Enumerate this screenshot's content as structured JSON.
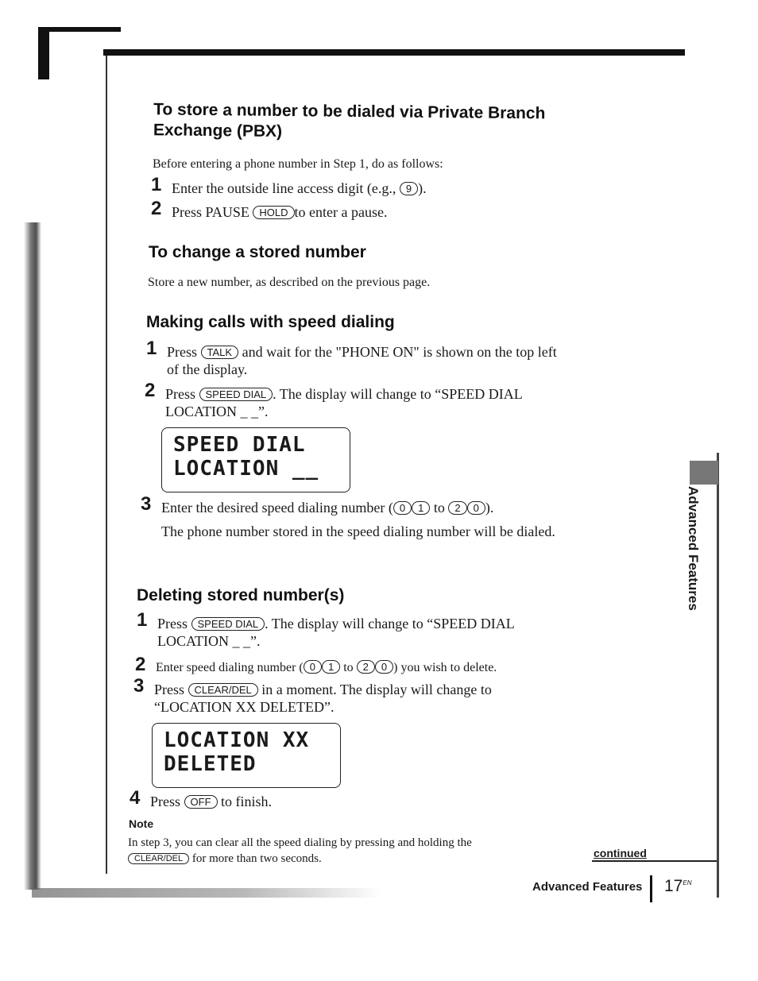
{
  "pbx": {
    "heading": "To store a number to be dialed via Private Branch Exchange (PBX)",
    "intro": "Before entering a phone number in Step 1, do as follows:",
    "steps": [
      {
        "num": "1",
        "text_before": "Enter the outside line access digit (e.g.,",
        "key": "9",
        "text_after": ")."
      },
      {
        "num": "2",
        "text_before": "Press PAUSE",
        "key": "HOLD",
        "text_after": "to enter a pause."
      }
    ]
  },
  "change": {
    "heading": "To change a stored number",
    "text": "Store a new number, as described on the previous page."
  },
  "speed": {
    "heading": "Making calls with speed dialing",
    "steps": [
      {
        "num": "1",
        "text_before": "Press",
        "key": "TALK",
        "text_after": "and wait for the \"PHONE ON\" is shown on the top left of the display."
      },
      {
        "num": "2",
        "text_before": "Press",
        "key": "SPEED DIAL",
        "text_after": ". The display will change to “SPEED DIAL LOCATION _ _”."
      },
      {
        "num": "3",
        "text_before": "Enter the desired speed dialing number (",
        "keys": [
          "0",
          "1",
          "2",
          "0"
        ],
        "to": "to",
        "text_after": ").",
        "text2": "The phone number stored in the speed dialing number will be dialed."
      }
    ],
    "lcd": {
      "line1": "SPEED DIAL",
      "line2": "LOCATION __"
    }
  },
  "delete": {
    "heading": "Deleting stored number(s)",
    "steps": [
      {
        "num": "1",
        "text_before": "Press",
        "key": "SPEED DIAL",
        "text_after": ". The display will change to “SPEED DIAL LOCATION _ _”."
      },
      {
        "num": "2",
        "text_before": "Enter speed dialing number (",
        "keys": [
          "0",
          "1",
          "2",
          "0"
        ],
        "to": "to",
        "text_after": ") you wish to delete."
      },
      {
        "num": "3",
        "text_before": "Press",
        "key": "CLEAR/DEL",
        "text_after": "in a moment. The display will change to “LOCATION XX DELETED”."
      },
      {
        "num": "4",
        "text_before": "Press",
        "key": "OFF",
        "text_after": "to finish."
      }
    ],
    "lcd": {
      "line1": "LOCATION XX",
      "line2": "DELETED"
    }
  },
  "note": {
    "label": "Note",
    "text_before": "In step 3, you can clear all the speed dialing by pressing and holding the",
    "key": "CLEAR/DEL",
    "text_after": "for more than two seconds."
  },
  "continued": "continued",
  "side_tab": "Advanced Features",
  "footer": {
    "section": "Advanced Features",
    "page": "17",
    "suffix": "EN"
  }
}
